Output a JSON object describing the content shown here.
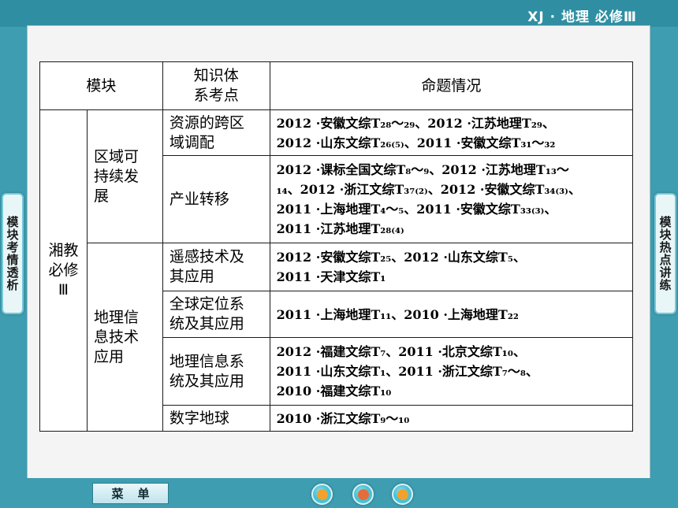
{
  "header": {
    "course_title": "XJ · 地理 必修Ⅲ"
  },
  "side_tabs": {
    "left": "模块考情透析",
    "right": "模块热点讲练"
  },
  "table": {
    "headers": [
      "模块",
      "知识体\n系考点",
      "命题情况"
    ],
    "module": "湘教\n必修\nⅢ",
    "rows": [
      {
        "unit": "区域可\n持续发\n展",
        "topic": "资源的跨区\n域调配",
        "exam": "2012 ·安徽文综T₂₈～₂₉、2012 ·江苏地理T₂₉、\n2012 ·山东文综T₂₆₍₅₎、2011 ·安徽文综T₃₁～₃₂"
      },
      {
        "topic": "产业转移",
        "exam": "2012 ·课标全国文综T₈～₉、2012 ·江苏地理T₁₃～\n₁₄、2012 ·浙江文综T₃₇₍₂₎、2012 ·安徽文综T₃₄₍₃₎、\n2011 ·上海地理T₄～₅、2011 ·安徽文综T₃₃₍₃₎、\n2011 ·江苏地理T₂₈₍₄₎"
      },
      {
        "unit": "地理信\n息技术\n应用",
        "topic": "遥感技术及\n其应用",
        "exam": "2012 ·安徽文综T₂₅、2012 ·山东文综T₅、\n2011 ·天津文综T₁"
      },
      {
        "topic": "全球定位系\n统及其应用",
        "exam": "2011 ·上海地理T₁₁、2010 ·上海地理T₂₂"
      },
      {
        "topic": "地理信息系\n统及其应用",
        "exam": "2012 ·福建文综T₇、2011 ·北京文综T₁₀、\n2011 ·山东文综T₁、2011 ·浙江文综T₇～₈、\n2010 ·福建文综T₁₀"
      },
      {
        "topic": "数字地球",
        "exam": "2010 ·浙江文综T₉～₁₀"
      }
    ]
  },
  "footer": {
    "menu_label": "菜单"
  }
}
